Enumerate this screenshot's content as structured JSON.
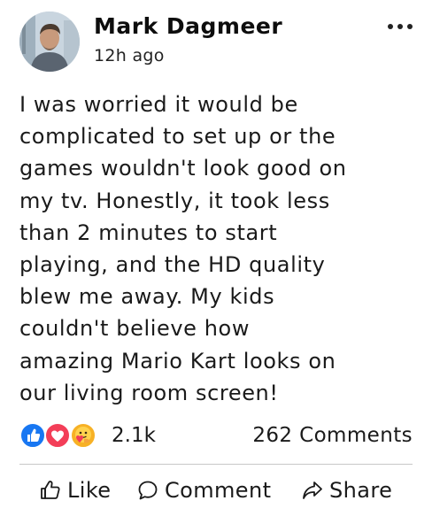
{
  "post": {
    "author": "Mark Dagmeer",
    "time": "12h ago",
    "body": "I was worried it would be\ncomplicated to set up or the\ngames wouldn't look good on\nmy tv. Honestly, it took less\nthan 2 minutes to start\nplaying, and the HD quality\nblew me away. My kids\ncouldn't believe how\namazing Mario Kart looks on\nour living room screen!"
  },
  "reactions": {
    "icons": [
      "like-reaction-icon",
      "love-reaction-icon",
      "care-reaction-icon"
    ],
    "count": "2.1k",
    "comments": "262 Comments"
  },
  "actions": {
    "like": "Like",
    "comment": "Comment",
    "share": "Share"
  },
  "colors": {
    "like_blue": "#1877f2",
    "love_red": "#f33e58",
    "care_yellow": "#f7b125",
    "text": "#1a1a1a",
    "divider": "#c8c8c8"
  }
}
